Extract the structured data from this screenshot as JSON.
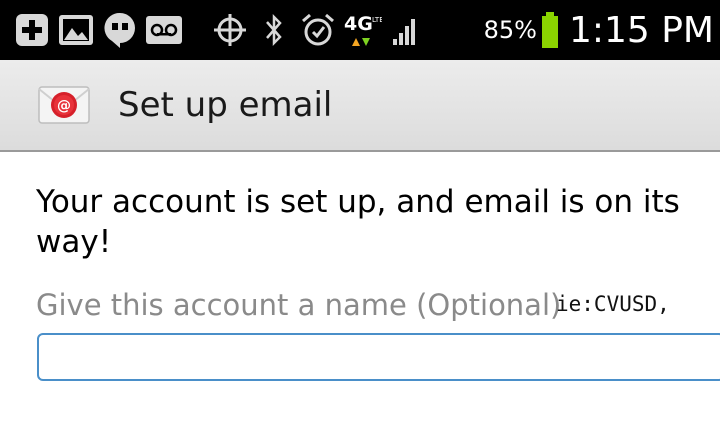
{
  "status_bar": {
    "icons": [
      "plus-icon",
      "image-icon",
      "hangouts-icon",
      "voicemail-icon",
      "gps-icon",
      "bluetooth-icon",
      "alarm-icon",
      "4g-lte-icon",
      "signal-icon",
      "battery-icon"
    ],
    "network": "4G",
    "battery_percent": "85%",
    "time": "1:15 PM",
    "battery_color": "#8bd400"
  },
  "action_bar": {
    "title": "Set up email",
    "icon": "email-app-icon"
  },
  "content": {
    "message": "Your account is set up, and email is on its way!",
    "name_label": "Give this account a name (Optional)",
    "name_hint": "ie:CVUSD,",
    "name_value": ""
  },
  "colors": {
    "input_border": "#4a8fc9",
    "label_gray": "#8a8a8a"
  }
}
